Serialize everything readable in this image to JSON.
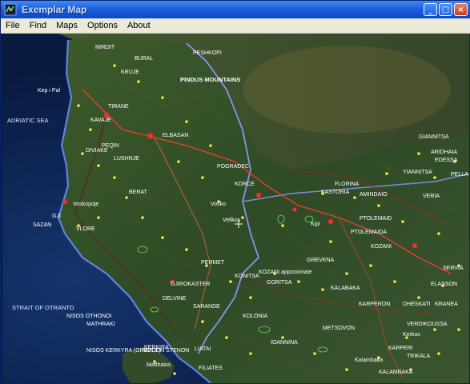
{
  "window": {
    "title": "Exemplar Map"
  },
  "titlebar_buttons": {
    "minimize": "_",
    "maximize": "□",
    "close": "×"
  },
  "menu": [
    "File",
    "Find",
    "Maps",
    "Options",
    "About"
  ],
  "map": {
    "seas": [
      {
        "text": "ADRIATIC SEA"
      },
      {
        "text": "STRAIT OF OTRANTO"
      },
      {
        "text": "Kep i Pal"
      },
      {
        "text": "NISOS OTHONOI"
      },
      {
        "text": "NISOS KERKYRA (GREECE)"
      }
    ],
    "places": [
      "MIRDIT",
      "BURAL",
      "PESHKOPI",
      "KRUJE",
      "PINDUS MOUNTAINS",
      "TIRANE",
      "KAVAJE",
      "ELBASAN",
      "PEQIN",
      "DIVIAKE",
      "LUSHNJE",
      "BERAT",
      "POGRADEC",
      "Vosko",
      "GJI",
      "SAZAN",
      "VLORE",
      "KORCE",
      "Voskopoje",
      "Velikos",
      "PERMET",
      "GJIROKASTER",
      "DELVINE",
      "SARANDE",
      "KERKIRA",
      "KONITSA",
      "FLORINA",
      "AMINDAIO",
      "KASTORIA",
      "PTOLEMAID",
      "KOZANI",
      "PTOLEMAIDA",
      "GREVENA",
      "IOANNINA",
      "DHESKATI",
      "KALABAKA",
      "TRIKALA",
      "METSOVON",
      "KARPERON",
      "SERVIA",
      "ELASSON",
      "VERDIKOUSSA",
      "KRANEA",
      "GIANNITSA",
      "EDESSA",
      "ARIDHAIA",
      "YIANNITSA",
      "PELLA",
      "VERIA",
      "MATHRAKI",
      "LIATAI",
      "KOLONIA",
      "GORITSA",
      "KOZANI approximate",
      "NOTION STENON",
      "Matthaios",
      "Kerkos",
      "Kipi",
      "KALAMBAKA",
      "Kalambaka",
      "FILIATES",
      "KARPERI"
    ]
  }
}
